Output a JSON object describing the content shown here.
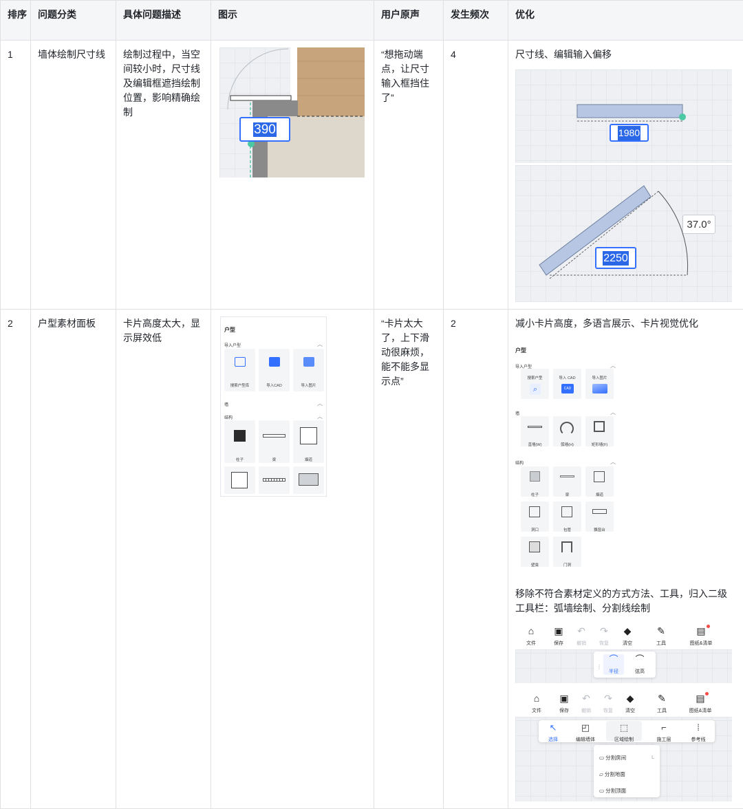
{
  "headers": [
    "排序",
    "问题分类",
    "具体问题描述",
    "图示",
    "用户原声",
    "发生频次",
    "优化"
  ],
  "rows": [
    {
      "rank": "1",
      "category": "墙体绘制尺寸线",
      "description": "绘制过程中，当空间较小时，尺寸线及编辑框遮挡绘制位置，影响精确绘制",
      "user_voice": "“想拖动端点，让尺寸输入框挡住了”",
      "frequency": "4",
      "optimization": "尺寸线、编辑输入偏移",
      "illustration": {
        "dimension_value": "390"
      },
      "optimized_images": {
        "straight_value": "1980",
        "angled_value": "2250",
        "angle_value": "37.0°"
      }
    },
    {
      "rank": "2",
      "category": "户型素材面板",
      "description": "卡片高度太大，显示屏效低",
      "user_voice": "“卡片太大了，上下滑动很麻烦，能不能多显示点”",
      "frequency": "2",
      "optimization": "减小卡片高度，多语言展示、卡片视觉优化",
      "optimization_2": "移除不符合素材定义的方式方法、工具，归入二级工具栏：弧墙绘制、分割线绘制",
      "old_panel": {
        "title": "户型",
        "section_import": "导入户型",
        "import_cards": [
          "搜索户型库",
          "导入CAD",
          "导入图片"
        ],
        "section_wall": "墙",
        "section_struct": "结构",
        "struct_cards": [
          "柱子",
          "梁",
          "烟道"
        ]
      },
      "new_panel": {
        "title": "户型",
        "section_import": "导入户型",
        "import_cards": [
          "搜索户型",
          "导入 CAD",
          "导入图片"
        ],
        "cad_badge": "CAD",
        "section_wall": "墙",
        "wall_cards": [
          "直墙(W)",
          "弧墙(H)",
          "矩形墙(F)"
        ],
        "section_struct": "结构",
        "struct_cards": [
          "柱子",
          "梁",
          "烟道",
          "洞口",
          "包管",
          "飘窗台",
          "壁龛",
          "门洞"
        ]
      },
      "toolbar": {
        "items": [
          "文件",
          "保存",
          "撤销",
          "恢复",
          "清空",
          "工具",
          "图纸&清单"
        ],
        "sub_arc": [
          "半径",
          "弦高"
        ],
        "sub_draw": [
          "选择",
          "编辑墙体",
          "区域绘制",
          "施工层",
          "参考线"
        ],
        "menu": [
          "分割房间",
          "分割地面",
          "分割顶面"
        ],
        "menu_shortcut": "L"
      }
    }
  ]
}
